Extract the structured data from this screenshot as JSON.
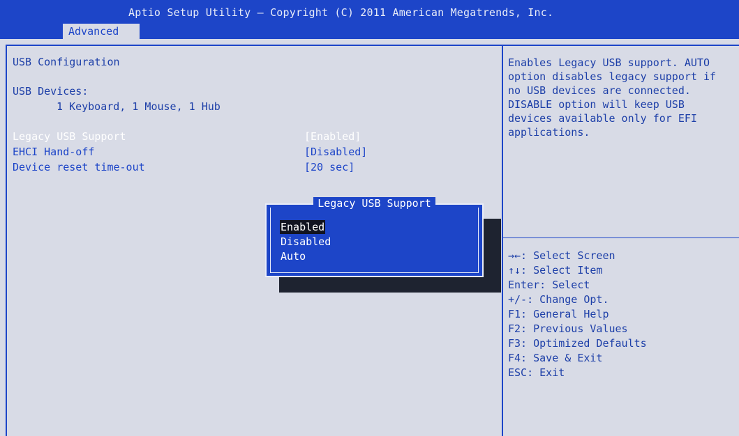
{
  "header": {
    "title": "Aptio Setup Utility – Copyright (C) 2011 American Megatrends, Inc.",
    "active_tab": "Advanced"
  },
  "main": {
    "section_title": "USB Configuration",
    "devices_label": "USB Devices:",
    "devices_value": "1 Keyboard, 1 Mouse, 1 Hub",
    "settings": [
      {
        "label": "Legacy USB Support",
        "value": "[Enabled]"
      },
      {
        "label": "EHCI Hand-off",
        "value": "[Disabled]"
      },
      {
        "label": "Device reset time-out",
        "value": "[20 sec]"
      }
    ]
  },
  "help_text": "Enables Legacy USB support. AUTO option disables legacy support if no USB devices are connected. DISABLE option will keep USB devices available only for EFI applications.",
  "keys": [
    "→←: Select Screen",
    "↑↓: Select Item",
    "Enter: Select",
    "+/-: Change Opt.",
    "F1: General Help",
    "F2: Previous Values",
    "F3: Optimized Defaults",
    "F4: Save & Exit",
    "ESC: Exit"
  ],
  "popup": {
    "title": "Legacy USB Support",
    "options": [
      "Enabled",
      "Disabled",
      "Auto"
    ],
    "selected": "Enabled"
  },
  "colors": {
    "header_blue": "#1d45c8",
    "background": "#d8dbe6",
    "text_blue": "#1d3fa8"
  }
}
